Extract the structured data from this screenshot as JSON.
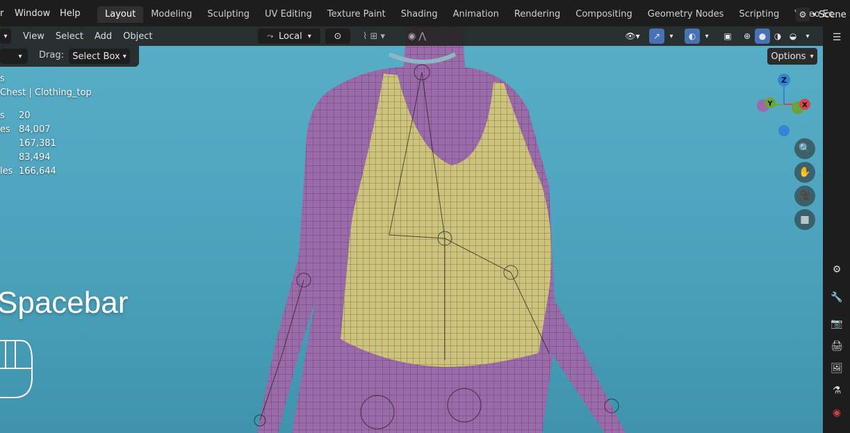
{
  "menu": {
    "items": [
      "r",
      "Window",
      "Help"
    ]
  },
  "workspaces": {
    "tabs": [
      "Layout",
      "Modeling",
      "Sculpting",
      "UV Editing",
      "Texture Paint",
      "Shading",
      "Animation",
      "Rendering",
      "Compositing",
      "Geometry Nodes",
      "Scripting",
      "Video Ec"
    ],
    "active": "Layout"
  },
  "scene": {
    "label": "Scene"
  },
  "viewport_header": {
    "menus": [
      "View",
      "Select",
      "Add",
      "Object"
    ],
    "transform_orientation": "Local",
    "options_label": "Options"
  },
  "tool_settings": {
    "drag_label": "Drag:",
    "drag_value": "Select Box"
  },
  "stats": {
    "partial_top": "s",
    "object_path": "Chest | Clothing_top",
    "rows": [
      {
        "label": "s",
        "value": "20"
      },
      {
        "label": "es",
        "value": "84,007"
      },
      {
        "label": "",
        "value": "167,381"
      },
      {
        "label": "",
        "value": "83,494"
      },
      {
        "label": "les",
        "value": "166,644"
      }
    ]
  },
  "overlay_text": "Spacebar",
  "gizmo": {
    "z": "Z",
    "y": "Y",
    "x": "X"
  },
  "colors": {
    "accent_blue": "#4772b3",
    "viewport_bg": "#57aec6",
    "body_mesh": "#9a6aa6",
    "cloth_mesh": "#c9c27a",
    "axis_x": "#d8444f",
    "axis_y": "#6ba33a",
    "axis_z": "#2f85d8"
  },
  "icons": [
    "zoom-icon",
    "hand-pan-icon",
    "camera-icon",
    "grid-perspective-icon",
    "tool-icon",
    "render-icon",
    "output-icon",
    "view-layer-icon",
    "scene-icon",
    "world-icon"
  ]
}
